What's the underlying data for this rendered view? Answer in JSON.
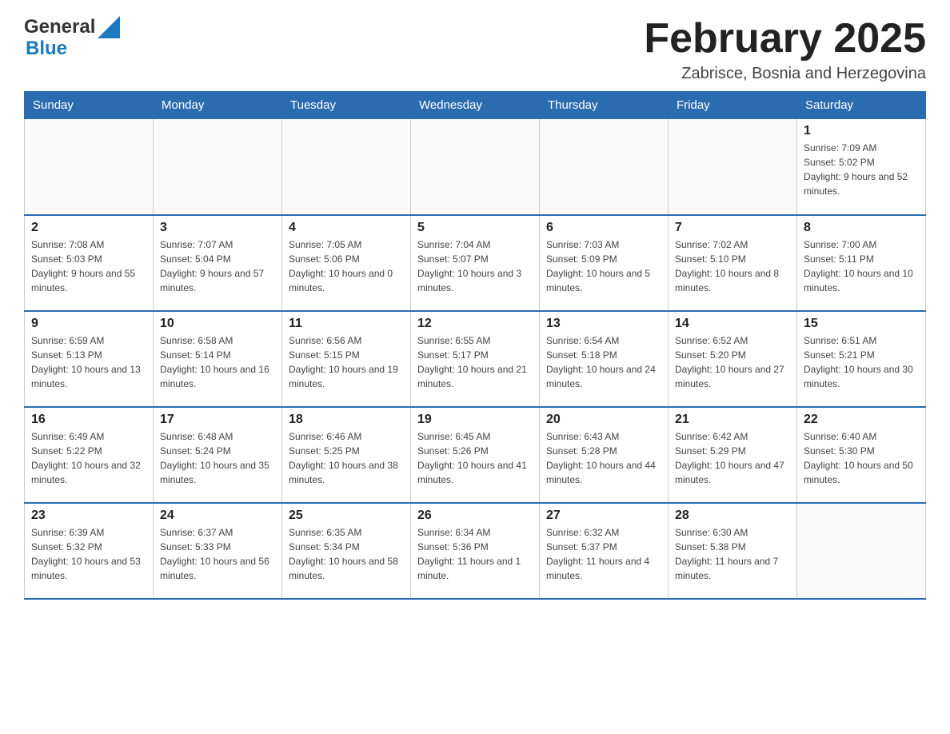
{
  "header": {
    "logo_general": "General",
    "logo_blue": "Blue",
    "month_title": "February 2025",
    "location": "Zabrisce, Bosnia and Herzegovina"
  },
  "days_of_week": [
    "Sunday",
    "Monday",
    "Tuesday",
    "Wednesday",
    "Thursday",
    "Friday",
    "Saturday"
  ],
  "weeks": [
    [
      {
        "day": "",
        "info": ""
      },
      {
        "day": "",
        "info": ""
      },
      {
        "day": "",
        "info": ""
      },
      {
        "day": "",
        "info": ""
      },
      {
        "day": "",
        "info": ""
      },
      {
        "day": "",
        "info": ""
      },
      {
        "day": "1",
        "info": "Sunrise: 7:09 AM\nSunset: 5:02 PM\nDaylight: 9 hours and 52 minutes."
      }
    ],
    [
      {
        "day": "2",
        "info": "Sunrise: 7:08 AM\nSunset: 5:03 PM\nDaylight: 9 hours and 55 minutes."
      },
      {
        "day": "3",
        "info": "Sunrise: 7:07 AM\nSunset: 5:04 PM\nDaylight: 9 hours and 57 minutes."
      },
      {
        "day": "4",
        "info": "Sunrise: 7:05 AM\nSunset: 5:06 PM\nDaylight: 10 hours and 0 minutes."
      },
      {
        "day": "5",
        "info": "Sunrise: 7:04 AM\nSunset: 5:07 PM\nDaylight: 10 hours and 3 minutes."
      },
      {
        "day": "6",
        "info": "Sunrise: 7:03 AM\nSunset: 5:09 PM\nDaylight: 10 hours and 5 minutes."
      },
      {
        "day": "7",
        "info": "Sunrise: 7:02 AM\nSunset: 5:10 PM\nDaylight: 10 hours and 8 minutes."
      },
      {
        "day": "8",
        "info": "Sunrise: 7:00 AM\nSunset: 5:11 PM\nDaylight: 10 hours and 10 minutes."
      }
    ],
    [
      {
        "day": "9",
        "info": "Sunrise: 6:59 AM\nSunset: 5:13 PM\nDaylight: 10 hours and 13 minutes."
      },
      {
        "day": "10",
        "info": "Sunrise: 6:58 AM\nSunset: 5:14 PM\nDaylight: 10 hours and 16 minutes."
      },
      {
        "day": "11",
        "info": "Sunrise: 6:56 AM\nSunset: 5:15 PM\nDaylight: 10 hours and 19 minutes."
      },
      {
        "day": "12",
        "info": "Sunrise: 6:55 AM\nSunset: 5:17 PM\nDaylight: 10 hours and 21 minutes."
      },
      {
        "day": "13",
        "info": "Sunrise: 6:54 AM\nSunset: 5:18 PM\nDaylight: 10 hours and 24 minutes."
      },
      {
        "day": "14",
        "info": "Sunrise: 6:52 AM\nSunset: 5:20 PM\nDaylight: 10 hours and 27 minutes."
      },
      {
        "day": "15",
        "info": "Sunrise: 6:51 AM\nSunset: 5:21 PM\nDaylight: 10 hours and 30 minutes."
      }
    ],
    [
      {
        "day": "16",
        "info": "Sunrise: 6:49 AM\nSunset: 5:22 PM\nDaylight: 10 hours and 32 minutes."
      },
      {
        "day": "17",
        "info": "Sunrise: 6:48 AM\nSunset: 5:24 PM\nDaylight: 10 hours and 35 minutes."
      },
      {
        "day": "18",
        "info": "Sunrise: 6:46 AM\nSunset: 5:25 PM\nDaylight: 10 hours and 38 minutes."
      },
      {
        "day": "19",
        "info": "Sunrise: 6:45 AM\nSunset: 5:26 PM\nDaylight: 10 hours and 41 minutes."
      },
      {
        "day": "20",
        "info": "Sunrise: 6:43 AM\nSunset: 5:28 PM\nDaylight: 10 hours and 44 minutes."
      },
      {
        "day": "21",
        "info": "Sunrise: 6:42 AM\nSunset: 5:29 PM\nDaylight: 10 hours and 47 minutes."
      },
      {
        "day": "22",
        "info": "Sunrise: 6:40 AM\nSunset: 5:30 PM\nDaylight: 10 hours and 50 minutes."
      }
    ],
    [
      {
        "day": "23",
        "info": "Sunrise: 6:39 AM\nSunset: 5:32 PM\nDaylight: 10 hours and 53 minutes."
      },
      {
        "day": "24",
        "info": "Sunrise: 6:37 AM\nSunset: 5:33 PM\nDaylight: 10 hours and 56 minutes."
      },
      {
        "day": "25",
        "info": "Sunrise: 6:35 AM\nSunset: 5:34 PM\nDaylight: 10 hours and 58 minutes."
      },
      {
        "day": "26",
        "info": "Sunrise: 6:34 AM\nSunset: 5:36 PM\nDaylight: 11 hours and 1 minute."
      },
      {
        "day": "27",
        "info": "Sunrise: 6:32 AM\nSunset: 5:37 PM\nDaylight: 11 hours and 4 minutes."
      },
      {
        "day": "28",
        "info": "Sunrise: 6:30 AM\nSunset: 5:38 PM\nDaylight: 11 hours and 7 minutes."
      },
      {
        "day": "",
        "info": ""
      }
    ]
  ]
}
